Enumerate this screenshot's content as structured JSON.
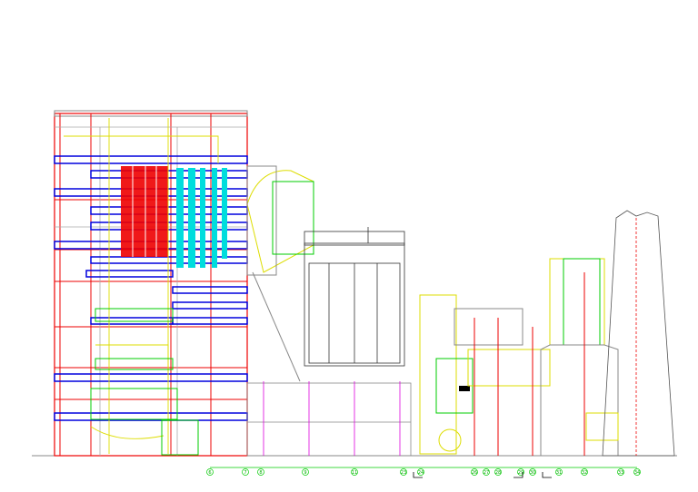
{
  "drawing": {
    "type": "boiler plant elevation CAD drawing",
    "colors": {
      "structure": "#e00000",
      "platform": "#0000e0",
      "furnace": "#e00000",
      "heat_exchanger": "#00e0e0",
      "duct": "#e0e000",
      "equipment": "#00c000",
      "steel": "#888888"
    },
    "axis_labels": [
      "6",
      "7",
      "8",
      "9",
      "11",
      "23",
      "24",
      "26",
      "27",
      "28",
      "29",
      "30",
      "31",
      "32",
      "33",
      "34"
    ]
  }
}
